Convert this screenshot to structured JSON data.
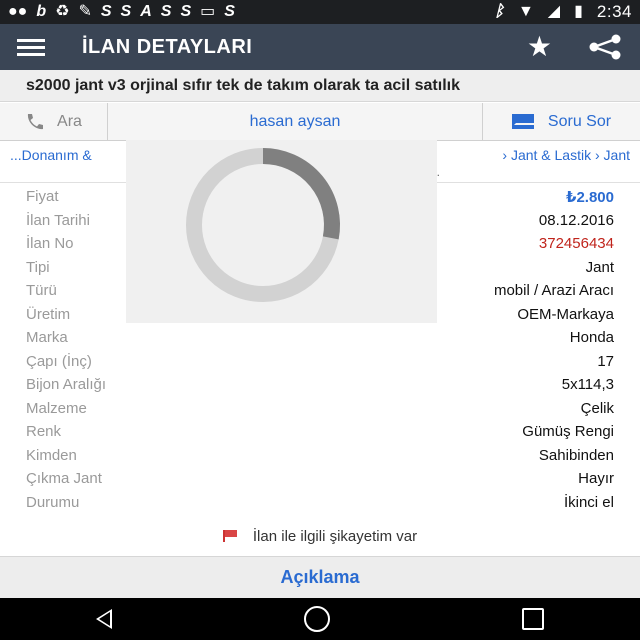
{
  "status_bar": {
    "left_icons": [
      "chat-icon",
      "b-icon",
      "recycle-icon",
      "wrench-icon",
      "sf-icon",
      "s-icon",
      "a-icon",
      "sf-icon",
      "sf-icon",
      "badge-icon",
      "s-icon"
    ],
    "left_glyphs": [
      "●●",
      "b",
      "♻",
      "✎",
      "S",
      "S",
      "A",
      "S",
      "S",
      "▭",
      "S"
    ],
    "time": "2:34"
  },
  "app_bar": {
    "title": "İLAN DETAYLARI",
    "menu_icon": "hamburger-icon",
    "star_icon": "star-icon",
    "share_icon": "share-icon"
  },
  "listing": {
    "title": "s2000 jant v3 orjinal sıfır tek de takım olarak ta acil satılık"
  },
  "contact": {
    "call_label": "Ara",
    "seller_name": "hasan aysan",
    "ask_label": "Soru Sor"
  },
  "breadcrumb": {
    "left": "...Donanım &",
    "right": "› Jant & Lastik › Jant",
    "sub": "n."
  },
  "details": [
    {
      "label": "Fiyat",
      "value": "₺2.800"
    },
    {
      "label": "İlan Tarihi",
      "value": "08.12.2016"
    },
    {
      "label": "İlan No",
      "value": "372456434"
    },
    {
      "label": "Tipi",
      "value": "Jant"
    },
    {
      "label": "Türü",
      "value": "mobil / Arazi Aracı"
    },
    {
      "label": "Üretim",
      "value": "OEM-Markaya"
    },
    {
      "label": "Marka",
      "value": "Honda"
    },
    {
      "label": "Çapı (İnç)",
      "value": "17"
    },
    {
      "label": "Bijon Aralığı",
      "value": "5x114,3"
    },
    {
      "label": "Malzeme",
      "value": "Çelik"
    },
    {
      "label": "Renk",
      "value": "Gümüş Rengi"
    },
    {
      "label": "Kimden",
      "value": "Sahibinden"
    },
    {
      "label": "Çıkma Jant",
      "value": "Hayır"
    },
    {
      "label": "Durumu",
      "value": "İkinci el"
    }
  ],
  "complaint": {
    "label": "İlan ile ilgili şikayetim var"
  },
  "description_tab": {
    "label": "Açıklama"
  },
  "loading": {
    "progress_fraction": 0.28
  },
  "colors": {
    "app_bar": "#3a4555",
    "accent": "#2a6bd1",
    "listing_id": "#c0241c"
  }
}
